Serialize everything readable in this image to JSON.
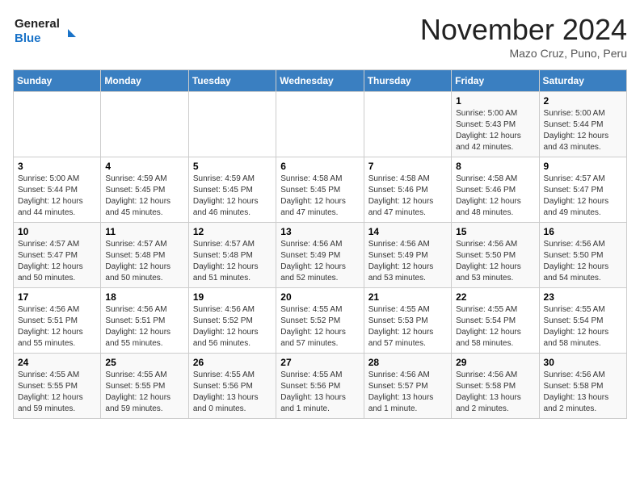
{
  "header": {
    "logo_line1": "General",
    "logo_line2": "Blue",
    "month": "November 2024",
    "location": "Mazo Cruz, Puno, Peru"
  },
  "weekdays": [
    "Sunday",
    "Monday",
    "Tuesday",
    "Wednesday",
    "Thursday",
    "Friday",
    "Saturday"
  ],
  "weeks": [
    [
      {
        "day": "",
        "info": ""
      },
      {
        "day": "",
        "info": ""
      },
      {
        "day": "",
        "info": ""
      },
      {
        "day": "",
        "info": ""
      },
      {
        "day": "",
        "info": ""
      },
      {
        "day": "1",
        "info": "Sunrise: 5:00 AM\nSunset: 5:43 PM\nDaylight: 12 hours\nand 42 minutes."
      },
      {
        "day": "2",
        "info": "Sunrise: 5:00 AM\nSunset: 5:44 PM\nDaylight: 12 hours\nand 43 minutes."
      }
    ],
    [
      {
        "day": "3",
        "info": "Sunrise: 5:00 AM\nSunset: 5:44 PM\nDaylight: 12 hours\nand 44 minutes."
      },
      {
        "day": "4",
        "info": "Sunrise: 4:59 AM\nSunset: 5:45 PM\nDaylight: 12 hours\nand 45 minutes."
      },
      {
        "day": "5",
        "info": "Sunrise: 4:59 AM\nSunset: 5:45 PM\nDaylight: 12 hours\nand 46 minutes."
      },
      {
        "day": "6",
        "info": "Sunrise: 4:58 AM\nSunset: 5:45 PM\nDaylight: 12 hours\nand 47 minutes."
      },
      {
        "day": "7",
        "info": "Sunrise: 4:58 AM\nSunset: 5:46 PM\nDaylight: 12 hours\nand 47 minutes."
      },
      {
        "day": "8",
        "info": "Sunrise: 4:58 AM\nSunset: 5:46 PM\nDaylight: 12 hours\nand 48 minutes."
      },
      {
        "day": "9",
        "info": "Sunrise: 4:57 AM\nSunset: 5:47 PM\nDaylight: 12 hours\nand 49 minutes."
      }
    ],
    [
      {
        "day": "10",
        "info": "Sunrise: 4:57 AM\nSunset: 5:47 PM\nDaylight: 12 hours\nand 50 minutes."
      },
      {
        "day": "11",
        "info": "Sunrise: 4:57 AM\nSunset: 5:48 PM\nDaylight: 12 hours\nand 50 minutes."
      },
      {
        "day": "12",
        "info": "Sunrise: 4:57 AM\nSunset: 5:48 PM\nDaylight: 12 hours\nand 51 minutes."
      },
      {
        "day": "13",
        "info": "Sunrise: 4:56 AM\nSunset: 5:49 PM\nDaylight: 12 hours\nand 52 minutes."
      },
      {
        "day": "14",
        "info": "Sunrise: 4:56 AM\nSunset: 5:49 PM\nDaylight: 12 hours\nand 53 minutes."
      },
      {
        "day": "15",
        "info": "Sunrise: 4:56 AM\nSunset: 5:50 PM\nDaylight: 12 hours\nand 53 minutes."
      },
      {
        "day": "16",
        "info": "Sunrise: 4:56 AM\nSunset: 5:50 PM\nDaylight: 12 hours\nand 54 minutes."
      }
    ],
    [
      {
        "day": "17",
        "info": "Sunrise: 4:56 AM\nSunset: 5:51 PM\nDaylight: 12 hours\nand 55 minutes."
      },
      {
        "day": "18",
        "info": "Sunrise: 4:56 AM\nSunset: 5:51 PM\nDaylight: 12 hours\nand 55 minutes."
      },
      {
        "day": "19",
        "info": "Sunrise: 4:56 AM\nSunset: 5:52 PM\nDaylight: 12 hours\nand 56 minutes."
      },
      {
        "day": "20",
        "info": "Sunrise: 4:55 AM\nSunset: 5:52 PM\nDaylight: 12 hours\nand 57 minutes."
      },
      {
        "day": "21",
        "info": "Sunrise: 4:55 AM\nSunset: 5:53 PM\nDaylight: 12 hours\nand 57 minutes."
      },
      {
        "day": "22",
        "info": "Sunrise: 4:55 AM\nSunset: 5:54 PM\nDaylight: 12 hours\nand 58 minutes."
      },
      {
        "day": "23",
        "info": "Sunrise: 4:55 AM\nSunset: 5:54 PM\nDaylight: 12 hours\nand 58 minutes."
      }
    ],
    [
      {
        "day": "24",
        "info": "Sunrise: 4:55 AM\nSunset: 5:55 PM\nDaylight: 12 hours\nand 59 minutes."
      },
      {
        "day": "25",
        "info": "Sunrise: 4:55 AM\nSunset: 5:55 PM\nDaylight: 12 hours\nand 59 minutes."
      },
      {
        "day": "26",
        "info": "Sunrise: 4:55 AM\nSunset: 5:56 PM\nDaylight: 13 hours\nand 0 minutes."
      },
      {
        "day": "27",
        "info": "Sunrise: 4:55 AM\nSunset: 5:56 PM\nDaylight: 13 hours\nand 1 minute."
      },
      {
        "day": "28",
        "info": "Sunrise: 4:56 AM\nSunset: 5:57 PM\nDaylight: 13 hours\nand 1 minute."
      },
      {
        "day": "29",
        "info": "Sunrise: 4:56 AM\nSunset: 5:58 PM\nDaylight: 13 hours\nand 2 minutes."
      },
      {
        "day": "30",
        "info": "Sunrise: 4:56 AM\nSunset: 5:58 PM\nDaylight: 13 hours\nand 2 minutes."
      }
    ]
  ]
}
